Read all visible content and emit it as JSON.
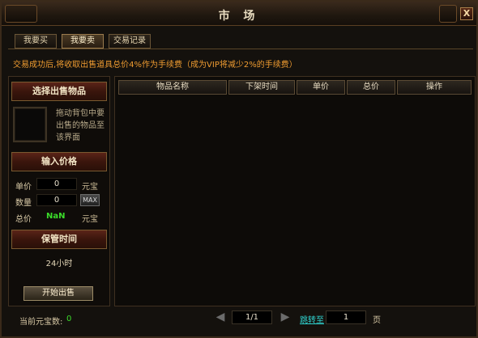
{
  "window": {
    "title": "市 场",
    "close_label": "X"
  },
  "tabs": [
    {
      "label": "我要买",
      "active": false
    },
    {
      "label": "我要卖",
      "active": true
    },
    {
      "label": "交易记录",
      "active": false
    }
  ],
  "notice": "交易成功后,将收取出售道具总价4%作为手续费（成为VIP将减少2%的手续费）",
  "sell_panel": {
    "select_item_title": "选择出售物品",
    "drag_hint": "拖动背包中要出售的物品至该界面",
    "price_title": "输入价格",
    "unit_price_label": "单价",
    "unit_price_value": "0",
    "unit_price_unit": "元宝",
    "quantity_label": "数量",
    "quantity_value": "0",
    "max_label": "MAX",
    "total_label": "总价",
    "total_value": "NaN",
    "total_unit": "元宝",
    "storage_title": "保管时间",
    "storage_value": "24小时",
    "start_sell_label": "开始出售"
  },
  "table": {
    "headers": [
      "物品名称",
      "下架时间",
      "单价",
      "总价",
      "操作"
    ],
    "rows": []
  },
  "footer": {
    "ingot_label": "当前元宝数:",
    "ingot_value": "0",
    "prev_icon": "left-arrow-icon",
    "next_icon": "right-arrow-icon",
    "page_display": "1/1",
    "jump_label": "跳转至",
    "jump_value": "1",
    "page_unit": "页"
  },
  "colors": {
    "notice": "#ef9c31",
    "green_value": "#3bdc2a",
    "link": "#2fd3d0"
  }
}
